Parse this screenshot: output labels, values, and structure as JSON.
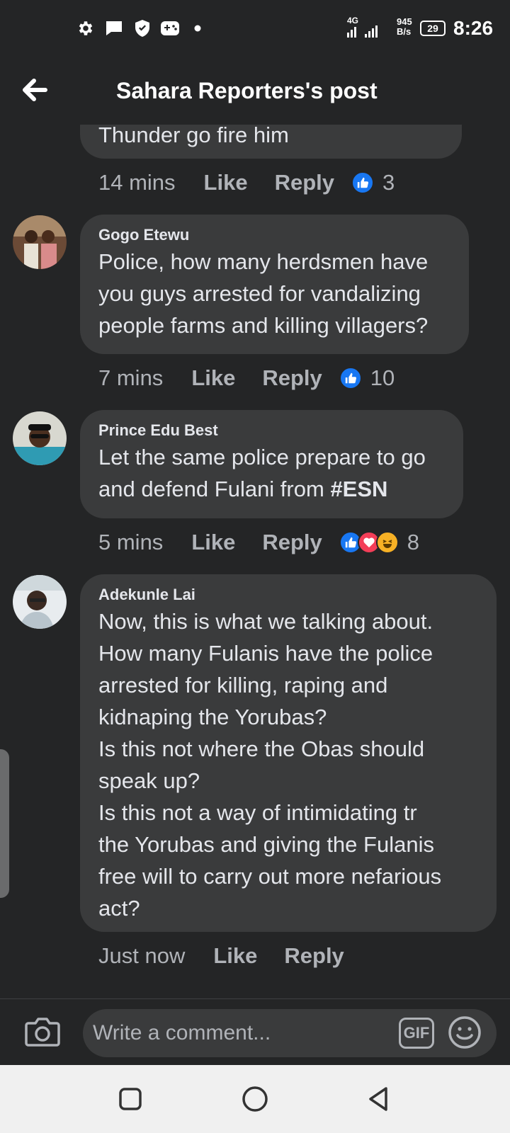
{
  "status_bar": {
    "network": "4G",
    "speed_value": "945",
    "speed_unit": "B/s",
    "battery": "29",
    "time": "8:26",
    "icons": [
      "gear-icon",
      "message-icon",
      "shield-icon",
      "gamepad-icon",
      "dot-icon",
      "signal-icon",
      "battery-icon"
    ]
  },
  "header": {
    "title": "Sahara Reporters's post"
  },
  "comments": [
    {
      "author": "",
      "text": "Thunder go fire him",
      "time": "14 mins",
      "like_label": "Like",
      "reply_label": "Reply",
      "reactions": [
        "like"
      ],
      "reaction_count": "3"
    },
    {
      "author": "Gogo Etewu",
      "text": "Police, how many herdsmen have\nyou guys arrested for vandalizing\npeople farms and killing villagers?",
      "time": "7 mins",
      "like_label": "Like",
      "reply_label": "Reply",
      "reactions": [
        "like"
      ],
      "reaction_count": "10"
    },
    {
      "author": "Prince Edu Best",
      "text_before": "Let the same police prepare to go\nand defend Fulani from ",
      "hashtag": "#ESN",
      "time": "5 mins",
      "like_label": "Like",
      "reply_label": "Reply",
      "reactions": [
        "like",
        "love",
        "haha"
      ],
      "reaction_count": "8"
    },
    {
      "author": "Adekunle Lai",
      "text": "Now, this is what we talking about.\nHow many Fulanis have the police\narrested for killing, raping and\nkidnaping the Yorubas?\nIs this not where the Obas should\nspeak up?\nIs this not a way of intimidating tr\nthe Yorubas and giving the Fulanis\nfree will to carry out more nefarious\nact?",
      "time": "Just now",
      "like_label": "Like",
      "reply_label": "Reply"
    }
  ],
  "composer": {
    "placeholder": "Write a comment...",
    "gif_label": "GIF"
  },
  "colors": {
    "background": "#242526",
    "bubble": "#3a3b3c",
    "like_blue": "#1877f2",
    "text_primary": "#e4e6eb",
    "text_secondary": "#b0b3b8"
  }
}
